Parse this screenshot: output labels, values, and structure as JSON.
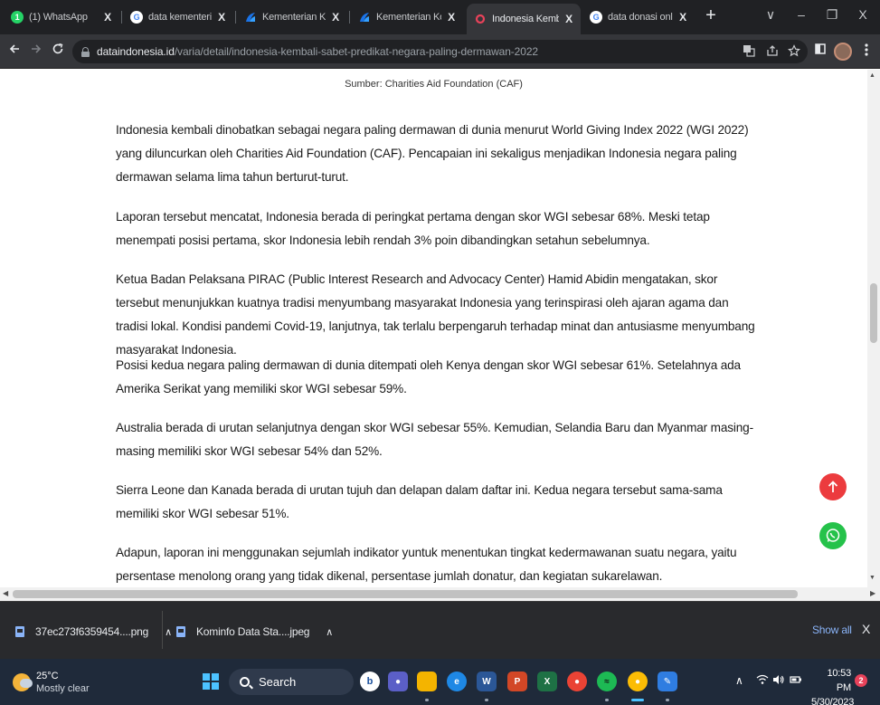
{
  "browser": {
    "tabs": [
      {
        "title": "(1) WhatsApp",
        "favicon": "whatsapp-icon",
        "color": "#25d366",
        "active": false
      },
      {
        "title": "data kementerian k",
        "favicon": "google-icon",
        "color": "#ffffff",
        "active": false
      },
      {
        "title": "Kementerian Komu",
        "favicon": "kominfo-icon",
        "color": "#1a73e8",
        "active": false
      },
      {
        "title": "Kementerian Komu",
        "favicon": "kominfo-icon",
        "color": "#1a73e8",
        "active": false
      },
      {
        "title": "Indonesia Kembali",
        "favicon": "dataindonesia-icon",
        "color": "#e8425a",
        "active": true
      },
      {
        "title": "data donasi online",
        "favicon": "google-icon",
        "color": "#ffffff",
        "active": false
      }
    ],
    "tab_close": "X",
    "new_tab": "+",
    "window_controls": {
      "dropdown": "∨",
      "minimize": "–",
      "restore": "❐",
      "close": "X"
    },
    "url_host": "dataindonesia.id",
    "url_path": "/varia/detail/indonesia-kembali-sabet-predikat-negara-paling-dermawan-2022"
  },
  "article": {
    "caption": "Sumber: Charities Aid Foundation (CAF)",
    "paragraphs": [
      "Indonesia kembali dinobatkan sebagai negara paling dermawan di dunia menurut World Giving Index 2022 (WGI 2022) yang diluncurkan oleh Charities Aid Foundation (CAF). Pencapaian ini sekaligus menjadikan Indonesia negara paling dermawan selama lima tahun berturut-turut.",
      "Laporan tersebut mencatat, Indonesia berada di peringkat pertama dengan skor WGI sebesar 68%. Meski tetap menempati posisi pertama, skor Indonesia lebih rendah 3% poin dibandingkan setahun sebelumnya.",
      "Ketua Badan Pelaksana PIRAC (Public Interest Research and Advocacy Center) Hamid Abidin mengatakan, skor tersebut menunjukkan kuatnya tradisi menyumbang masyarakat Indonesia yang terinspirasi oleh ajaran agama dan tradisi lokal. Kondisi pandemi Covid-19, lanjutnya, tak terlalu berpengaruh terhadap minat dan antusiasme menyumbang masyarakat Indonesia.",
      "Posisi kedua negara paling dermawan di dunia ditempati oleh Kenya dengan skor WGI sebesar 61%. Setelahnya ada Amerika Serikat yang memiliki skor WGI sebesar 59%.",
      "Australia berada di urutan selanjutnya dengan skor WGI sebesar 55%. Kemudian, Selandia Baru dan Myanmar masing-masing memiliki skor WGI sebesar 54% dan 52%.",
      "Sierra Leone dan Kanada berada di urutan tujuh dan delapan dalam daftar ini. Kedua negara tersebut sama-sama memiliki skor WGI sebesar 51%.",
      "Adapun, laporan ini menggunakan sejumlah indikator yuntuk menentukan tingkat kedermawanan suatu negara, yaitu persentase menolong orang yang tidak dikenal, persentase jumlah donatur, dan kegiatan sukarelawan."
    ]
  },
  "downloads": {
    "items": [
      {
        "name": "37ec273f6359454....png"
      },
      {
        "name": "Kominfo Data Sta....jpeg"
      }
    ],
    "show_all": "Show all",
    "close": "X"
  },
  "taskbar": {
    "temperature": "25°C",
    "condition": "Mostly clear",
    "search_label": "Search",
    "time": "10:53 PM",
    "date": "5/30/2023",
    "notification_count": "2",
    "tray_chevron": "∧"
  },
  "colors": {
    "scroll_top_button": "#ec3b3e",
    "whatsapp_button": "#25c24a",
    "link": "#8ab4f8"
  }
}
